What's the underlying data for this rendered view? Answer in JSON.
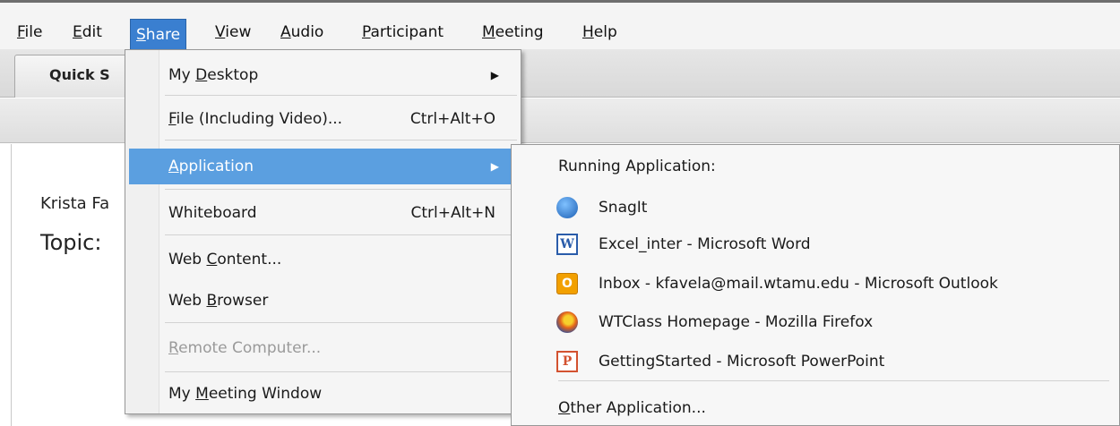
{
  "menubar": {
    "items": [
      {
        "id": "file",
        "mnemonic": "F",
        "rest": "ile"
      },
      {
        "id": "edit",
        "mnemonic": "E",
        "rest": "dit"
      },
      {
        "id": "share",
        "mnemonic": "S",
        "rest": "hare"
      },
      {
        "id": "view",
        "mnemonic": "V",
        "rest": "iew"
      },
      {
        "id": "audio",
        "mnemonic": "A",
        "rest": "udio"
      },
      {
        "id": "participant",
        "mnemonic": "P",
        "rest": "articipant"
      },
      {
        "id": "meeting",
        "mnemonic": "M",
        "rest": "eeting"
      },
      {
        "id": "help",
        "mnemonic": "H",
        "rest": "elp"
      }
    ]
  },
  "tabs": {
    "quick_start": "Quick S"
  },
  "content": {
    "host_name": "Krista Fa",
    "topic_label": "Topic:"
  },
  "share_menu": {
    "my_desktop": {
      "pre": "My ",
      "mn": "D",
      "post": "esktop"
    },
    "file": {
      "pre": "",
      "mn": "F",
      "post": "ile (Including Video)...",
      "shortcut": "Ctrl+Alt+O"
    },
    "application": {
      "pre": "",
      "mn": "A",
      "post": "pplication"
    },
    "whiteboard": {
      "label": "Whiteboard",
      "shortcut": "Ctrl+Alt+N"
    },
    "web_content": {
      "pre": "Web ",
      "mn": "C",
      "post": "ontent..."
    },
    "web_browser": {
      "pre": "Web ",
      "mn": "B",
      "post": "rowser"
    },
    "remote_computer": {
      "pre": "",
      "mn": "R",
      "post": "emote Computer..."
    },
    "my_meeting_window": {
      "pre": "My ",
      "mn": "M",
      "post": "eeting Window"
    }
  },
  "app_menu": {
    "heading": "Running Application:",
    "items": [
      {
        "label": "SnagIt",
        "icon": "snagit-icon"
      },
      {
        "label": "Excel_inter - Microsoft Word",
        "icon": "word-icon",
        "glyph": "W"
      },
      {
        "label": "Inbox - kfavela@mail.wtamu.edu - Microsoft Outlook",
        "icon": "outlook-icon",
        "glyph": "O"
      },
      {
        "label": "WTClass Homepage - Mozilla Firefox",
        "icon": "firefox-icon"
      },
      {
        "label": "GettingStarted - Microsoft PowerPoint",
        "icon": "powerpoint-icon",
        "glyph": "P"
      }
    ],
    "other": {
      "mn": "O",
      "post": "ther Application..."
    }
  }
}
